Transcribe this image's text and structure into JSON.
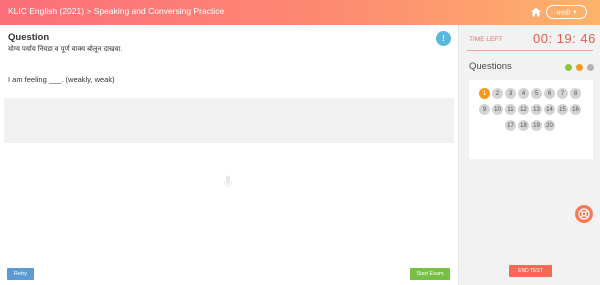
{
  "header": {
    "breadcrumb": "KLIC English (2021) > Speaking and Conversing Practice",
    "language": "मराठी",
    "language_caret": "▾",
    "home_icon": "home-icon"
  },
  "question": {
    "title": "Question",
    "instruction": "योग्य पर्याय निवडा व पूर्ण वाक्य बोलून दाखवा.",
    "sentence": "I am feeling ___. (weakly, weak)",
    "info_label": "!"
  },
  "buttons": {
    "retry": "Retry",
    "start_exam": "Start Exam",
    "end_test": "END TEST"
  },
  "timer": {
    "label": "TIME LEFT",
    "value": "00: 19: 46"
  },
  "palette": {
    "heading": "Questions",
    "legend_colors": [
      "#8cc63f",
      "#f29a1f",
      "#b3b3b3"
    ],
    "numbers": [
      "1",
      "2",
      "3",
      "4",
      "5",
      "6",
      "7",
      "8",
      "9",
      "10",
      "11",
      "12",
      "13",
      "14",
      "15",
      "16",
      "17",
      "18",
      "19",
      "20"
    ],
    "current": "1"
  },
  "colors": {
    "header_gradient": [
      "#fc6e7a",
      "#fdb36a"
    ],
    "accent_timer": "#e65c4f",
    "retry": "#5b9bd5",
    "start": "#76c043",
    "end": "#f56a57"
  }
}
